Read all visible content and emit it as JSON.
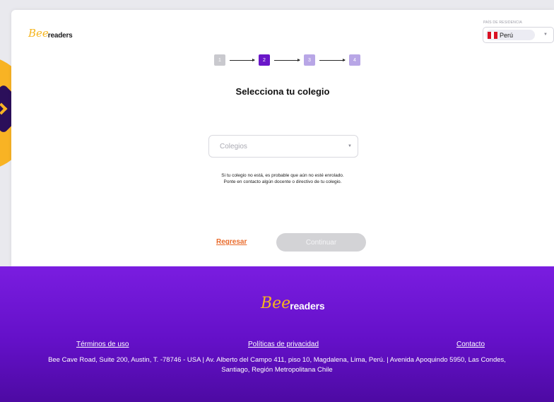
{
  "header": {
    "logo": {
      "bee": "Bee",
      "readers": "readers"
    },
    "country": {
      "label": "PAÍS DE RESIDENCIA",
      "selected": "Perú",
      "flag_colors": [
        "#d91023",
        "#ffffff",
        "#d91023"
      ]
    }
  },
  "stepper": {
    "steps": [
      "1",
      "2",
      "3",
      "4"
    ],
    "current": 2,
    "colors": {
      "done": "#c9c9ce",
      "active": "#6a17c9",
      "pending": "#b8a6e6"
    }
  },
  "main": {
    "title": "Selecciona tu colegio",
    "school_select": {
      "placeholder": "Colegios"
    },
    "info_line_1": "Si tu colegio no está, es probable que aún no esté enrolado.",
    "info_line_2": "Ponte en contacto algún docente o directivo de tu colegio."
  },
  "actions": {
    "back_label": "Regresar",
    "continue_label": "Continuar"
  },
  "footer": {
    "logo": {
      "bee": "Bee",
      "readers": "readers"
    },
    "links": [
      "Términos de uso",
      "Políticas de privacidad",
      "Contacto"
    ],
    "address_line_1": "Bee Cave Road, Suite 200, Austin, T. -78746 - USA | Av. Alberto del Campo 411, piso 10, Magdalena, Lima, Perú. | Avenida Apoquindo 5950, Las Condes,",
    "address_line_2": "Santiago, Región Metropolitana Chile"
  },
  "colors": {
    "accent": "#6a17c9",
    "link": "#e96a2a",
    "brand_yellow": "#f8b324",
    "footer_bg": "#6410c8"
  }
}
